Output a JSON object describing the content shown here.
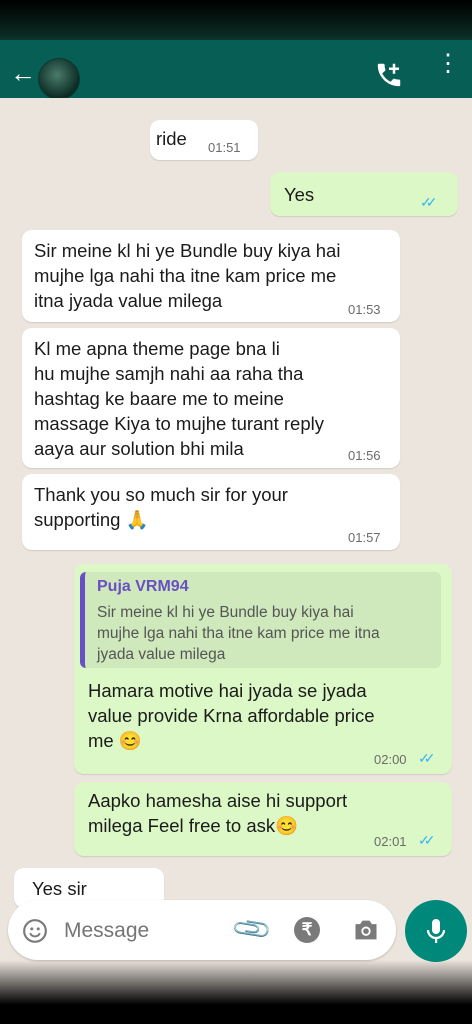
{
  "header": {
    "back_icon": "arrow-left-icon",
    "call_icon": "add-call-icon",
    "menu_icon": "more-vert-icon"
  },
  "messages": [
    {
      "text": "ride",
      "time": "01:51"
    },
    {
      "text": "Yes",
      "time": "",
      "ticks": "✓✓"
    },
    {
      "text": "Sir meine kl hi ye Bundle buy kiya hai\nmujhe lga nahi tha  itne kam price me\nitna jyada value milega",
      "time": "01:53"
    },
    {
      "text": "Kl me apna theme page bna li\nhu mujhe samjh nahi aa raha tha\nhashtag ke baare me to meine\nmassage Kiya to mujhe turant reply\naaya aur solution bhi mila",
      "time": "01:56"
    },
    {
      "text": "Thank you so much sir for your\nsupporting 🙏",
      "time": "01:57"
    },
    {
      "quote_author": "Puja VRM94",
      "quote_text": "Sir meine kl hi ye Bundle buy kiya hai\nmujhe lga nahi tha  itne kam price me itna\njyada value milega",
      "text": "Hamara motive hai jyada se jyada\nvalue provide Krna affordable price\nme 😊",
      "time": "02:00",
      "ticks": "✓✓"
    },
    {
      "text": "Aapko hamesha aise hi support\nmilega Feel free to ask😊",
      "time": "02:01",
      "ticks": "✓✓"
    },
    {
      "text": "Yes sir"
    }
  ],
  "input": {
    "placeholder": "Message",
    "emoji_icon": "emoji-icon",
    "attach_icon": "paperclip-icon",
    "rupee_icon": "rupee-icon",
    "camera_icon": "camera-icon",
    "mic_icon": "mic-icon"
  },
  "colors": {
    "header": "#075e54",
    "outgoing": "#dcf8c6",
    "incoming": "#ffffff",
    "ticks": "#34b7f1",
    "fab": "#00897b"
  }
}
